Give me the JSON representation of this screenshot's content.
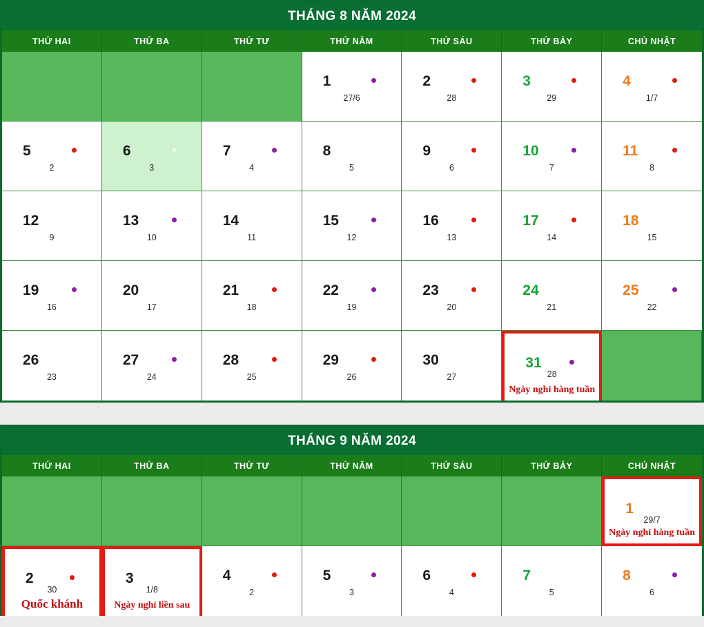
{
  "colors": {
    "title_bg": "#086e31",
    "weekday_bg": "#1a7d1a",
    "empty_cell": "#56b75b",
    "today_cell": "#cdf2cd",
    "grid_border": "#3f8c45",
    "highlight_border": "#e41b13",
    "saturday_text": "#18a437",
    "sunday_text": "#ef7b1b",
    "note_text": "#c10f0f",
    "dot_red": "#e01b0e",
    "dot_purple": "#8b1fa9",
    "page_bg": "#ececec"
  },
  "weekdays": [
    "THỨ HAI",
    "THỨ BA",
    "THỨ TƯ",
    "THỨ NĂM",
    "THỨ SÁU",
    "THỨ BẢY",
    "CHỦ NHẬT"
  ],
  "months": [
    {
      "title": "THÁNG 8 NĂM 2024",
      "weeks": [
        [
          {
            "empty": true
          },
          {
            "empty": true
          },
          {
            "empty": true
          },
          {
            "day": "1",
            "lunar": "27/6",
            "dot": "purple",
            "kind": "weekday"
          },
          {
            "day": "2",
            "lunar": "28",
            "dot": "red",
            "kind": "weekday"
          },
          {
            "day": "3",
            "lunar": "29",
            "dot": "red",
            "kind": "sat"
          },
          {
            "day": "4",
            "lunar": "1/7",
            "dot": "red",
            "kind": "sun"
          }
        ],
        [
          {
            "day": "5",
            "lunar": "2",
            "dot": "red",
            "kind": "weekday"
          },
          {
            "day": "6",
            "lunar": "3",
            "dot": "hollow",
            "kind": "weekday",
            "today": true
          },
          {
            "day": "7",
            "lunar": "4",
            "dot": "purple",
            "kind": "weekday"
          },
          {
            "day": "8",
            "lunar": "5",
            "dot": "none",
            "kind": "weekday"
          },
          {
            "day": "9",
            "lunar": "6",
            "dot": "red",
            "kind": "weekday"
          },
          {
            "day": "10",
            "lunar": "7",
            "dot": "purple",
            "kind": "sat"
          },
          {
            "day": "11",
            "lunar": "8",
            "dot": "red",
            "kind": "sun"
          }
        ],
        [
          {
            "day": "12",
            "lunar": "9",
            "dot": "none",
            "kind": "weekday"
          },
          {
            "day": "13",
            "lunar": "10",
            "dot": "purple",
            "kind": "weekday"
          },
          {
            "day": "14",
            "lunar": "11",
            "dot": "none",
            "kind": "weekday"
          },
          {
            "day": "15",
            "lunar": "12",
            "dot": "purple",
            "kind": "weekday"
          },
          {
            "day": "16",
            "lunar": "13",
            "dot": "red",
            "kind": "weekday"
          },
          {
            "day": "17",
            "lunar": "14",
            "dot": "red",
            "kind": "sat"
          },
          {
            "day": "18",
            "lunar": "15",
            "dot": "none",
            "kind": "sun"
          }
        ],
        [
          {
            "day": "19",
            "lunar": "16",
            "dot": "purple",
            "kind": "weekday"
          },
          {
            "day": "20",
            "lunar": "17",
            "dot": "none",
            "kind": "weekday"
          },
          {
            "day": "21",
            "lunar": "18",
            "dot": "red",
            "kind": "weekday"
          },
          {
            "day": "22",
            "lunar": "19",
            "dot": "purple",
            "kind": "weekday"
          },
          {
            "day": "23",
            "lunar": "20",
            "dot": "red",
            "kind": "weekday"
          },
          {
            "day": "24",
            "lunar": "21",
            "dot": "none",
            "kind": "sat"
          },
          {
            "day": "25",
            "lunar": "22",
            "dot": "purple",
            "kind": "sun"
          }
        ],
        [
          {
            "day": "26",
            "lunar": "23",
            "dot": "none",
            "kind": "weekday"
          },
          {
            "day": "27",
            "lunar": "24",
            "dot": "purple",
            "kind": "weekday"
          },
          {
            "day": "28",
            "lunar": "25",
            "dot": "red",
            "kind": "weekday"
          },
          {
            "day": "29",
            "lunar": "26",
            "dot": "red",
            "kind": "weekday"
          },
          {
            "day": "30",
            "lunar": "27",
            "dot": "none",
            "kind": "weekday"
          },
          {
            "day": "31",
            "lunar": "28",
            "dot": "purple",
            "kind": "sat",
            "note": "Ngày nghỉ hàng tuần",
            "highlight": true
          },
          {
            "empty": true
          }
        ]
      ]
    },
    {
      "title": "THÁNG 9 NĂM 2024",
      "weeks": [
        [
          {
            "empty": true
          },
          {
            "empty": true
          },
          {
            "empty": true
          },
          {
            "empty": true
          },
          {
            "empty": true
          },
          {
            "empty": true
          },
          {
            "day": "1",
            "lunar": "29/7",
            "dot": "none",
            "kind": "sun",
            "note": "Ngày nghỉ hàng tuần",
            "highlight": true
          }
        ],
        [
          {
            "day": "2",
            "lunar": "30",
            "dot": "red",
            "kind": "weekday",
            "note": "Quốc khánh",
            "note_big": true,
            "highlight": true
          },
          {
            "day": "3",
            "lunar": "1/8",
            "dot": "none",
            "kind": "weekday",
            "note": "Ngày nghỉ liền sau",
            "highlight": true
          },
          {
            "day": "4",
            "lunar": "2",
            "dot": "red",
            "kind": "weekday"
          },
          {
            "day": "5",
            "lunar": "3",
            "dot": "purple",
            "kind": "weekday"
          },
          {
            "day": "6",
            "lunar": "4",
            "dot": "red",
            "kind": "weekday"
          },
          {
            "day": "7",
            "lunar": "5",
            "dot": "none",
            "kind": "sat"
          },
          {
            "day": "8",
            "lunar": "6",
            "dot": "purple",
            "kind": "sun"
          }
        ]
      ]
    }
  ]
}
